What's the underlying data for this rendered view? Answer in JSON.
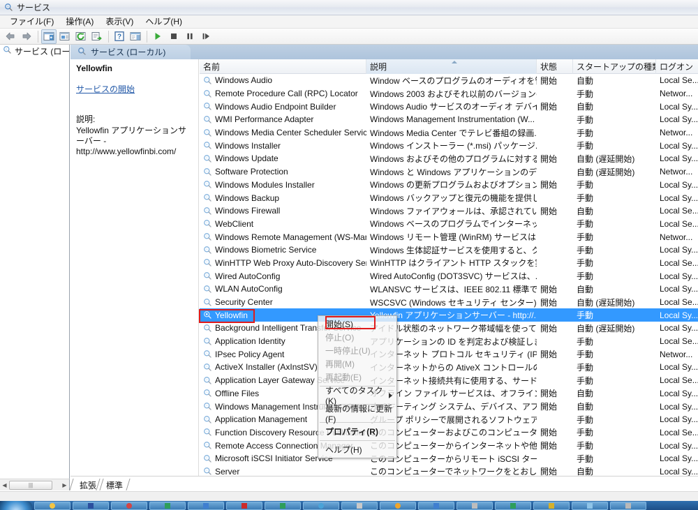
{
  "window": {
    "title": "サービス",
    "icon": "services-gear-icon"
  },
  "menubar": {
    "items": [
      {
        "name": "file",
        "label": "ファイル(F)"
      },
      {
        "name": "action",
        "label": "操作(A)"
      },
      {
        "name": "view",
        "label": "表示(V)"
      },
      {
        "name": "help",
        "label": "ヘルプ(H)"
      }
    ]
  },
  "toolbar": {
    "buttons": [
      {
        "name": "back-button",
        "icon": "arrow-left-icon"
      },
      {
        "name": "forward-button",
        "icon": "arrow-right-icon"
      },
      {
        "name": "show-hide-console-tree-button",
        "icon": "console-tree-icon"
      },
      {
        "name": "properties-button",
        "icon": "properties-window-icon"
      },
      {
        "name": "refresh-button",
        "icon": "refresh-icon"
      },
      {
        "name": "export-list-button",
        "icon": "export-list-icon"
      },
      {
        "name": "help-button",
        "icon": "question-mark-icon"
      },
      {
        "name": "show-action-pane-button",
        "icon": "action-pane-icon"
      },
      {
        "name": "start-service-button",
        "icon": "play-icon"
      },
      {
        "name": "stop-service-button",
        "icon": "stop-icon"
      },
      {
        "name": "pause-service-button",
        "icon": "pause-icon"
      },
      {
        "name": "restart-service-button",
        "icon": "restart-icon"
      }
    ]
  },
  "tree": {
    "root_label": "サービス (ローカル)",
    "root_icon": "services-gear-icon"
  },
  "right_pane": {
    "tab_label": "サービス (ローカル)",
    "tab_icon": "services-gear-icon"
  },
  "detail_panel": {
    "service_name": "Yellowfin",
    "action_link": "サービスの開始",
    "description_label": "説明:",
    "description_body": "Yellowfin アプリケーションサーバー - http://www.yellowfinbi.com/"
  },
  "columns": [
    {
      "name": "name",
      "label": "名前",
      "sorted": false
    },
    {
      "name": "description",
      "label": "説明",
      "sorted": true
    },
    {
      "name": "state",
      "label": "状態",
      "sorted": false
    },
    {
      "name": "startup_type",
      "label": "スタートアップの種類",
      "sorted": false
    },
    {
      "name": "log_on_as",
      "label": "ログオン",
      "sorted": false
    }
  ],
  "rows": [
    {
      "name": "Windows Audio",
      "description": "Window ベースのプログラムのオーディオを管...",
      "state": "開始",
      "startup": "自動",
      "logon": "Local Se...",
      "selected": false
    },
    {
      "name": "Remote Procedure Call (RPC) Locator",
      "description": "Windows 2003 およびそれ以前のバージョンの...",
      "state": "",
      "startup": "手動",
      "logon": "Networ...",
      "selected": false
    },
    {
      "name": "Windows Audio Endpoint Builder",
      "description": "Windows Audio サービスのオーディオ デバイ...",
      "state": "開始",
      "startup": "自動",
      "logon": "Local Sy...",
      "selected": false
    },
    {
      "name": "WMI Performance Adapter",
      "description": "Windows Management Instrumentation (W...",
      "state": "",
      "startup": "手動",
      "logon": "Local Sy...",
      "selected": false
    },
    {
      "name": "Windows Media Center Scheduler Service",
      "description": "Windows Media Center でテレビ番組の録画...",
      "state": "",
      "startup": "手動",
      "logon": "Networ...",
      "selected": false
    },
    {
      "name": "Windows Installer",
      "description": "Windows インストーラー (*.msi) パッケージ...",
      "state": "",
      "startup": "手動",
      "logon": "Local Sy...",
      "selected": false
    },
    {
      "name": "Windows Update",
      "description": "Windows およびその他のプログラムに対する...",
      "state": "開始",
      "startup": "自動 (遅延開始)",
      "logon": "Local Sy...",
      "selected": false
    },
    {
      "name": "Software Protection",
      "description": "Windows と Windows アプリケーションのデ...",
      "state": "",
      "startup": "自動 (遅延開始)",
      "logon": "Networ...",
      "selected": false
    },
    {
      "name": "Windows Modules Installer",
      "description": "Windows の更新プログラムおよびオプション ...",
      "state": "開始",
      "startup": "手動",
      "logon": "Local Sy...",
      "selected": false
    },
    {
      "name": "Windows Backup",
      "description": "Windows バックアップと復元の機能を提供し...",
      "state": "",
      "startup": "手動",
      "logon": "Local Sy...",
      "selected": false
    },
    {
      "name": "Windows Firewall",
      "description": "Windows ファイアウォールは、承認されてい...",
      "state": "開始",
      "startup": "自動",
      "logon": "Local Se...",
      "selected": false
    },
    {
      "name": "WebClient",
      "description": "Windows ベースのプログラムでインターネッ...",
      "state": "",
      "startup": "手動",
      "logon": "Local Se...",
      "selected": false
    },
    {
      "name": "Windows Remote Management (WS-Man...",
      "description": "Windows リモート管理 (WinRM) サービスは...",
      "state": "",
      "startup": "手動",
      "logon": "Networ...",
      "selected": false
    },
    {
      "name": "Windows Biometric Service",
      "description": "Windows 生体認証サービスを使用すると、ク...",
      "state": "",
      "startup": "手動",
      "logon": "Local Sy...",
      "selected": false
    },
    {
      "name": "WinHTTP Web Proxy Auto-Discovery Ser...",
      "description": "WinHTTP はクライアント HTTP スタックを実...",
      "state": "",
      "startup": "手動",
      "logon": "Local Se...",
      "selected": false
    },
    {
      "name": "Wired AutoConfig",
      "description": "Wired AutoConfig (DOT3SVC) サービスは、...",
      "state": "",
      "startup": "手動",
      "logon": "Local Sy...",
      "selected": false
    },
    {
      "name": "WLAN AutoConfig",
      "description": "WLANSVC サービスは、IEEE 802.11 標準で...",
      "state": "開始",
      "startup": "自動",
      "logon": "Local Sy...",
      "selected": false
    },
    {
      "name": "Security Center",
      "description": "WSCSVC (Windows セキュリティ センター) ...",
      "state": "開始",
      "startup": "自動 (遅延開始)",
      "logon": "Local Se...",
      "selected": false
    },
    {
      "name": "Yellowfin",
      "description": "Yellowfin アプリケーションサーバー - http://...",
      "state": "",
      "startup": "手動",
      "logon": "Local Sy...",
      "selected": true
    },
    {
      "name": "Background Intelligent Transfer Service",
      "description": "アイドル状態のネットワーク帯域幅を使ってバ...",
      "state": "開始",
      "startup": "自動 (遅延開始)",
      "logon": "Local Sy...",
      "selected": false
    },
    {
      "name": "Application Identity",
      "description": "アプリケーションの ID を判定および検証しま...",
      "state": "",
      "startup": "手動",
      "logon": "Local Se...",
      "selected": false
    },
    {
      "name": "IPsec Policy Agent",
      "description": "インターネット プロトコル セキュリティ (IPs...",
      "state": "開始",
      "startup": "手動",
      "logon": "Networ...",
      "selected": false
    },
    {
      "name": "ActiveX Installer (AxInstSV)",
      "description": "インターネットからの AtiveX コントロールの...",
      "state": "",
      "startup": "手動",
      "logon": "Local Sy...",
      "selected": false
    },
    {
      "name": "Application Layer Gateway Service",
      "description": "インターネット接続共有に使用する、サード パ...",
      "state": "",
      "startup": "手動",
      "logon": "Local Se...",
      "selected": false
    },
    {
      "name": "Offline Files",
      "description": "オフライン ファイル サービスは、オフライン ...",
      "state": "開始",
      "startup": "自動",
      "logon": "Local Sy...",
      "selected": false
    },
    {
      "name": "Windows Management Instrumentation",
      "description": "オペレーティング システム、デバイス、アプリ...",
      "state": "開始",
      "startup": "自動",
      "logon": "Local Sy...",
      "selected": false
    },
    {
      "name": "Application Management",
      "description": "グループ ポリシーで展開されるソフトウェアに...",
      "state": "",
      "startup": "手動",
      "logon": "Local Sy...",
      "selected": false
    },
    {
      "name": "Function Discovery Resource Publication",
      "description": "このコンピューターおよびこのコンピューター...",
      "state": "開始",
      "startup": "手動",
      "logon": "Local Se...",
      "selected": false
    },
    {
      "name": "Remote Access Connection Manager",
      "description": "このコンピューターからインターネットや他の...",
      "state": "開始",
      "startup": "手動",
      "logon": "Local Sy...",
      "selected": false
    },
    {
      "name": "Microsoft iSCSI Initiator Service",
      "description": "このコンピューターからリモート iSCSI ターゲ...",
      "state": "",
      "startup": "手動",
      "logon": "Local Sy...",
      "selected": false
    },
    {
      "name": "Server",
      "description": "このコンピューターでネットワークをとおして...",
      "state": "開始",
      "startup": "自動",
      "logon": "Local Sy...",
      "selected": false
    }
  ],
  "context_menu": {
    "items": [
      {
        "name": "start",
        "label": "開始(S)",
        "disabled": false,
        "bold": false,
        "submenu": false,
        "highlighted": true
      },
      {
        "name": "stop",
        "label": "停止(O)",
        "disabled": true,
        "bold": false,
        "submenu": false
      },
      {
        "name": "pause",
        "label": "一時停止(U)",
        "disabled": true,
        "bold": false,
        "submenu": false
      },
      {
        "name": "resume",
        "label": "再開(M)",
        "disabled": true,
        "bold": false,
        "submenu": false
      },
      {
        "name": "restart",
        "label": "再起動(E)",
        "disabled": true,
        "bold": false,
        "submenu": false
      },
      {
        "sep": true
      },
      {
        "name": "all-tasks",
        "label": "すべてのタスク(K)",
        "disabled": false,
        "bold": false,
        "submenu": true
      },
      {
        "sep": true
      },
      {
        "name": "refresh",
        "label": "最新の情報に更新(F)",
        "disabled": false,
        "bold": false,
        "submenu": false
      },
      {
        "sep": true
      },
      {
        "name": "properties",
        "label": "プロパティ(R)",
        "disabled": false,
        "bold": true,
        "submenu": false
      },
      {
        "sep": true
      },
      {
        "name": "help",
        "label": "ヘルプ(H)",
        "disabled": false,
        "bold": false,
        "submenu": false
      }
    ]
  },
  "bottom_tabs": [
    {
      "name": "extended",
      "label": "拡張",
      "active": true
    },
    {
      "name": "standard",
      "label": "標準",
      "active": false
    }
  ],
  "colors": {
    "selection_blue": "#3399ff",
    "annotation_red": "#e01b1b",
    "link_blue": "#2359a8"
  }
}
